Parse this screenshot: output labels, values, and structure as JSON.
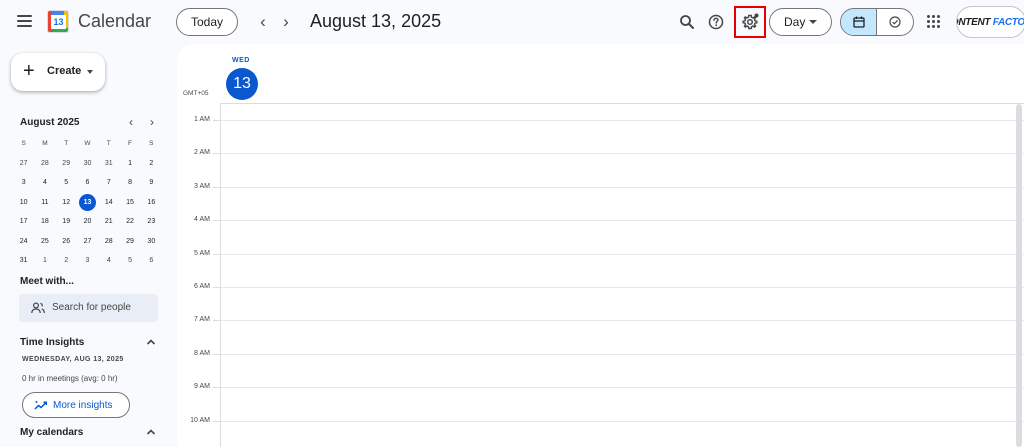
{
  "header": {
    "app_title": "Calendar",
    "logo_number": "13",
    "today_label": "Today",
    "date_title": "August 13, 2025",
    "view_selector": "Day",
    "account_brand_prefix": "CONTENT",
    "account_brand_suffix": "FACTORY",
    "icons": [
      "menu-icon",
      "chevron-left-icon",
      "chevron-right-icon",
      "search-icon",
      "help-icon",
      "settings-icon",
      "calendar-view-icon",
      "tasks-view-icon",
      "apps-grid-icon"
    ],
    "highlight_color": "#e60000"
  },
  "sidebar": {
    "create_label": "Create",
    "mini_calendar": {
      "title": "August 2025",
      "weekdays": [
        "S",
        "M",
        "T",
        "W",
        "T",
        "F",
        "S"
      ],
      "weeks": [
        [
          "27",
          "28",
          "29",
          "30",
          "31",
          "1",
          "2"
        ],
        [
          "3",
          "4",
          "5",
          "6",
          "7",
          "8",
          "9"
        ],
        [
          "10",
          "11",
          "12",
          "13",
          "14",
          "15",
          "16"
        ],
        [
          "17",
          "18",
          "19",
          "20",
          "21",
          "22",
          "23"
        ],
        [
          "24",
          "25",
          "26",
          "27",
          "28",
          "29",
          "30"
        ],
        [
          "31",
          "1",
          "2",
          "3",
          "4",
          "5",
          "6"
        ]
      ],
      "selected_day": "13"
    },
    "meet_with": {
      "title": "Meet with...",
      "search_placeholder": "Search for people"
    },
    "time_insights": {
      "title": "Time Insights",
      "date": "WEDNESDAY, AUG 13, 2025",
      "meetings": "0 hr in meetings (avg: 0 hr)",
      "more_label": "More insights"
    },
    "my_calendars": {
      "title": "My calendars"
    }
  },
  "main": {
    "day_name": "WED",
    "day_number": "13",
    "timezone": "GMT+05",
    "hours": [
      "1 AM",
      "2 AM",
      "3 AM",
      "4 AM",
      "5 AM",
      "6 AM",
      "7 AM",
      "8 AM",
      "9 AM",
      "10 AM"
    ],
    "accent_color": "#0b57d0"
  }
}
